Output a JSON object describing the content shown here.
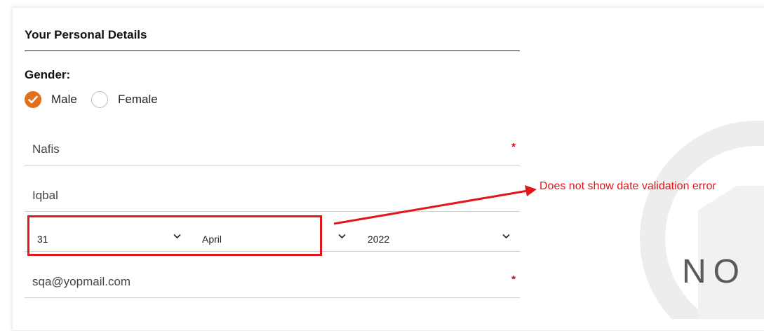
{
  "form": {
    "section_title": "Your Personal Details",
    "gender_label": "Gender:",
    "gender_options": [
      {
        "label": "Male",
        "selected": true
      },
      {
        "label": "Female",
        "selected": false
      }
    ],
    "first_name": {
      "value": "Nafis",
      "required_mark": "*"
    },
    "last_name": {
      "value": "Iqbal"
    },
    "dob": {
      "day": "31",
      "month": "April",
      "year": "2022"
    },
    "email": {
      "value": "sqa@yopmail.com",
      "required_mark": "*"
    }
  },
  "annotation": {
    "text": "Does not show date validation error",
    "color": "#e4161b"
  },
  "background": {
    "watermark_text": "NO"
  },
  "colors": {
    "accent": "#e2701b",
    "required": "#d0021b"
  }
}
